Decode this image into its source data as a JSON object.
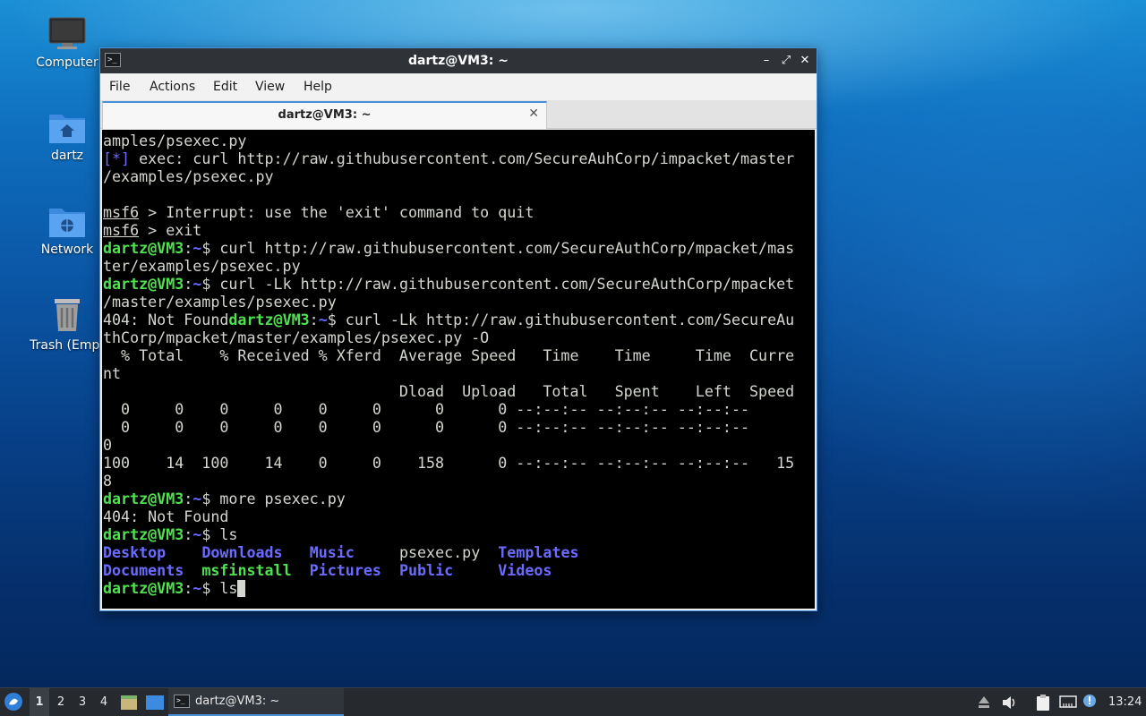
{
  "desktop": {
    "icons": [
      {
        "label": "Computer",
        "icon": "monitor-icon"
      },
      {
        "label": "dartz",
        "icon": "home-folder-icon"
      },
      {
        "label": "Network",
        "icon": "network-folder-icon"
      },
      {
        "label": "Trash (Empt",
        "icon": "trash-icon"
      }
    ]
  },
  "window": {
    "title": "dartz@VM3: ~",
    "controls": {
      "minimize": "–",
      "maximize": "⤢",
      "close": "✕"
    },
    "menu": [
      "File",
      "Actions",
      "Edit",
      "View",
      "Help"
    ],
    "tab": {
      "label": "dartz@VM3: ~",
      "close": "✕"
    }
  },
  "terminal": {
    "lines": [
      [
        {
          "t": "amples/psexec.py"
        }
      ],
      [
        {
          "t": "[*]",
          "c": "bb"
        },
        {
          "t": " exec: curl http://raw.githubusercontent.com/SecureAuhCorp/impacket/master"
        }
      ],
      [
        {
          "t": "/examples/psexec.py"
        }
      ],
      [
        {
          "t": ""
        }
      ],
      [
        {
          "t": "msf6",
          "c": "u"
        },
        {
          "t": " > Interrupt: use the 'exit' command to quit"
        }
      ],
      [
        {
          "t": "msf6",
          "c": "u"
        },
        {
          "t": " > exit"
        }
      ],
      [
        {
          "t": "dartz@VM3",
          "c": "g"
        },
        {
          "t": ":"
        },
        {
          "t": "~",
          "c": "b"
        },
        {
          "t": "$ curl http://raw.githubusercontent.com/SecureAuthCorp/mpacket/mas"
        }
      ],
      [
        {
          "t": "ter/examples/psexec.py"
        }
      ],
      [
        {
          "t": "dartz@VM3",
          "c": "g"
        },
        {
          "t": ":"
        },
        {
          "t": "~",
          "c": "b"
        },
        {
          "t": "$ curl -Lk http://raw.githubusercontent.com/SecureAuthCorp/mpacket"
        }
      ],
      [
        {
          "t": "/master/examples/psexec.py"
        }
      ],
      [
        {
          "t": "404: Not Found"
        },
        {
          "t": "dartz@VM3",
          "c": "g"
        },
        {
          "t": ":"
        },
        {
          "t": "~",
          "c": "b"
        },
        {
          "t": "$ curl -Lk http://raw.githubusercontent.com/SecureAu"
        }
      ],
      [
        {
          "t": "thCorp/mpacket/master/examples/psexec.py -O"
        }
      ],
      [
        {
          "t": "  % Total    % Received % Xferd  Average Speed   Time    Time     Time  Curre"
        }
      ],
      [
        {
          "t": "nt"
        }
      ],
      [
        {
          "t": "                                 Dload  Upload   Total   Spent    Left  Speed"
        }
      ],
      [
        {
          "t": "  0     0    0     0    0     0      0      0 --:--:-- --:--:-- --:--:--"
        }
      ],
      [
        {
          "t": "  0     0    0     0    0     0      0      0 --:--:-- --:--:-- --:--:--"
        }
      ],
      [
        {
          "t": "0"
        }
      ],
      [
        {
          "t": "100    14  100    14    0     0    158      0 --:--:-- --:--:-- --:--:--   15"
        }
      ],
      [
        {
          "t": "8"
        }
      ],
      [
        {
          "t": "dartz@VM3",
          "c": "g"
        },
        {
          "t": ":"
        },
        {
          "t": "~",
          "c": "b"
        },
        {
          "t": "$ more psexec.py"
        }
      ],
      [
        {
          "t": "404: Not Found"
        }
      ],
      [
        {
          "t": "dartz@VM3",
          "c": "g"
        },
        {
          "t": ":"
        },
        {
          "t": "~",
          "c": "b"
        },
        {
          "t": "$ ls"
        }
      ],
      [
        {
          "t": "Desktop",
          "c": "b"
        },
        {
          "t": "    "
        },
        {
          "t": "Downloads",
          "c": "b"
        },
        {
          "t": "   "
        },
        {
          "t": "Music",
          "c": "b"
        },
        {
          "t": "     psexec.py  "
        },
        {
          "t": "Templates",
          "c": "b"
        }
      ],
      [
        {
          "t": "Documents",
          "c": "b"
        },
        {
          "t": "  "
        },
        {
          "t": "msfinstall",
          "c": "gb"
        },
        {
          "t": "  "
        },
        {
          "t": "Pictures",
          "c": "b"
        },
        {
          "t": "  "
        },
        {
          "t": "Public",
          "c": "b"
        },
        {
          "t": "     "
        },
        {
          "t": "Videos",
          "c": "b"
        }
      ],
      [
        {
          "t": "dartz@VM3",
          "c": "g"
        },
        {
          "t": ":"
        },
        {
          "t": "~",
          "c": "b"
        },
        {
          "t": "$ ls"
        }
      ]
    ]
  },
  "taskbar": {
    "workspaces": [
      "1",
      "2",
      "3",
      "4"
    ],
    "active_workspace": "1",
    "task_label": "dartz@VM3: ~",
    "clock": "13:24"
  },
  "colors": {
    "prompt_user": "#4fe14f",
    "directory": "#6b6bff",
    "terminal_bg": "#000000",
    "window_border": "#4a90d9"
  }
}
